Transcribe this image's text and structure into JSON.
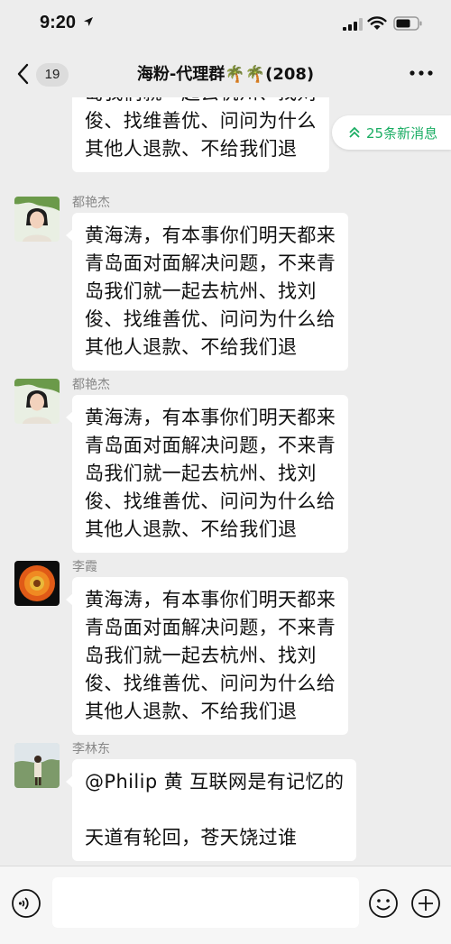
{
  "status_bar": {
    "time": "9:20"
  },
  "nav": {
    "unread_count": "19",
    "title": "海粉-代理群🌴🌴(208)"
  },
  "new_messages_pill": {
    "label": "25条新消息"
  },
  "messages": [
    {
      "sender": "",
      "text": "岛我们就一起去杭州、找刘\n俊、找维善优、问问为什么\n其他人退款、不给我们退",
      "avatar": ""
    },
    {
      "sender": "都艳杰",
      "text": "黄海涛，有本事你们明天都来\n青岛面对面解决问题，不来青\n岛我们就一起去杭州、找刘\n俊、找维善优、问问为什么给\n其他人退款、不给我们退",
      "avatar": "woman-portrait"
    },
    {
      "sender": "都艳杰",
      "text": "黄海涛，有本事你们明天都来\n青岛面对面解决问题，不来青\n岛我们就一起去杭州、找刘\n俊、找维善优、问问为什么给\n其他人退款、不给我们退",
      "avatar": "woman-portrait"
    },
    {
      "sender": "李霞",
      "text": "黄海涛，有本事你们明天都来\n青岛面对面解决问题，不来青\n岛我们就一起去杭州、找刘\n俊、找维善优、问问为什么给\n其他人退款、不给我们退",
      "avatar": "orange-flower"
    },
    {
      "sender": "李林东",
      "text": "@Philip 黄 互联网是有记忆的\n\n天道有轮回，苍天饶过谁",
      "avatar": "outdoor-photo"
    }
  ],
  "input": {
    "placeholder": ""
  },
  "colors": {
    "background": "#ededed",
    "bubble": "#ffffff",
    "accent_green": "#1aad63",
    "sender_gray": "#888888"
  }
}
